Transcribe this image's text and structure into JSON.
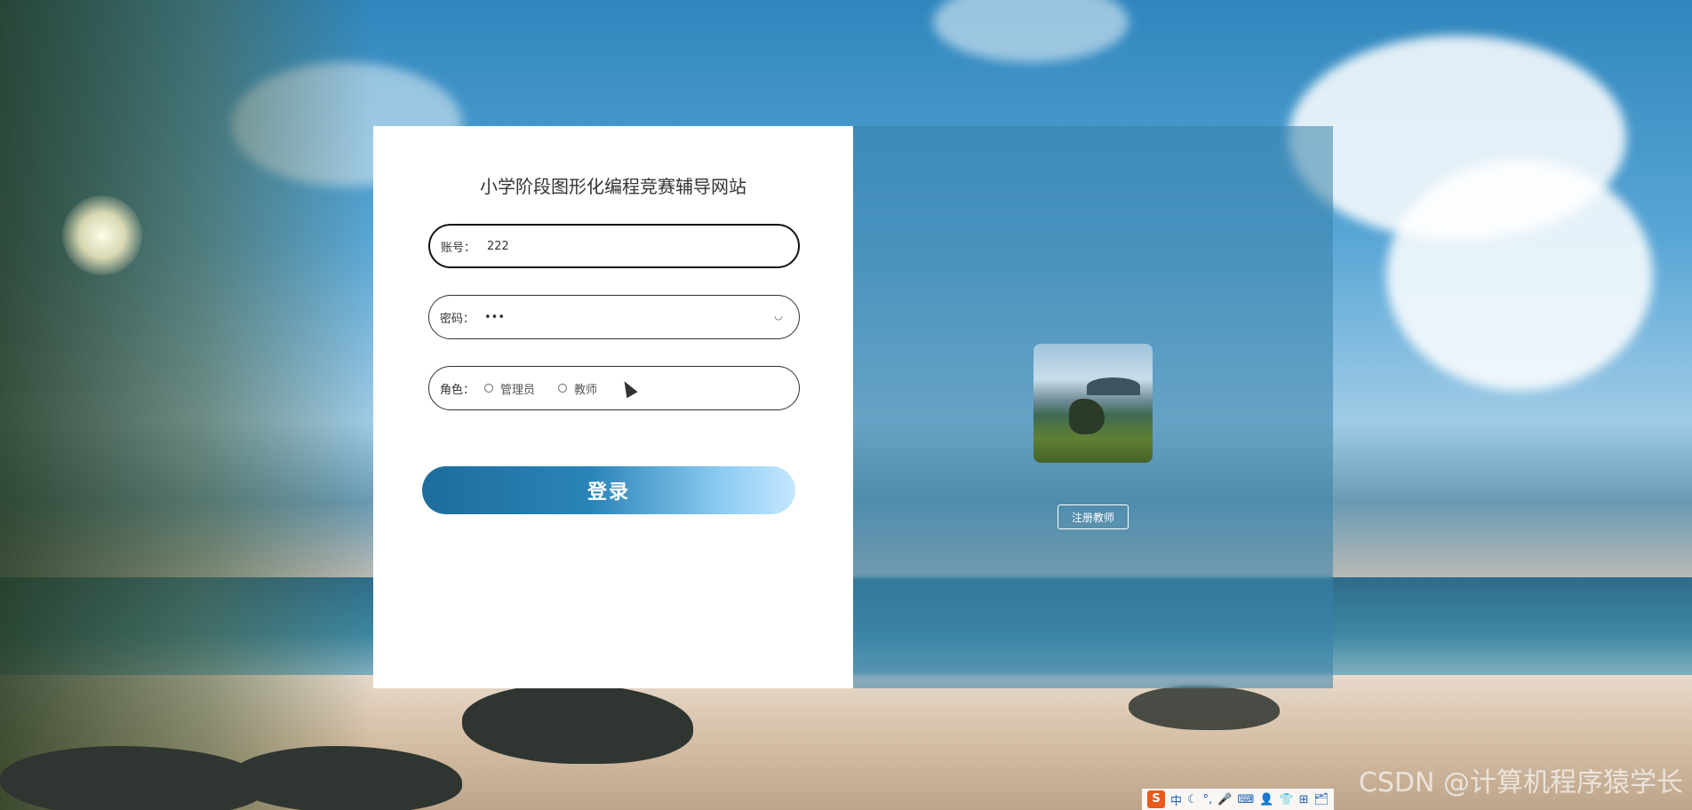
{
  "site": {
    "title": "小学阶段图形化编程竞赛辅导网站"
  },
  "form": {
    "account_label": "账号：",
    "account_value": "222",
    "password_label": "密码：",
    "password_value": "•••",
    "role_label": "角色：",
    "roles": [
      "管理员",
      "教师"
    ],
    "login_label": "登录"
  },
  "right_panel": {
    "register_label": "注册教师"
  },
  "watermark": "CSDN @计算机程序猿学长",
  "ime": {
    "logo": "S",
    "items": [
      "中",
      "☾",
      "°,",
      "🎤",
      "⌨",
      "👤",
      "👕",
      "⊞",
      "🗂"
    ]
  },
  "icons": {
    "eye": "eye-closed-icon",
    "cursor": "mouse-cursor-icon"
  }
}
